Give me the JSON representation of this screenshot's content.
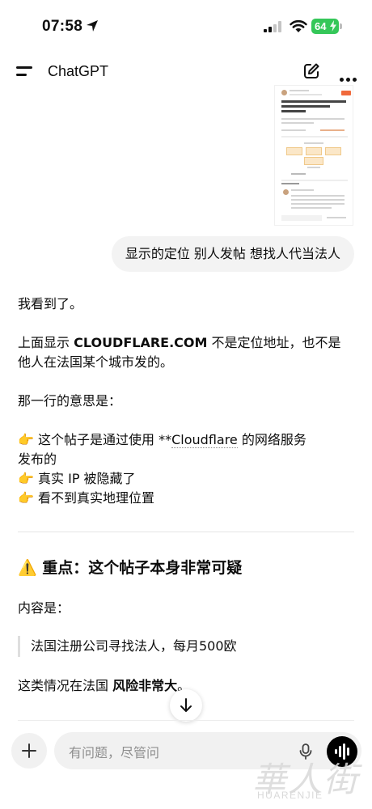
{
  "status_bar": {
    "time": "07:58",
    "battery_level": "64"
  },
  "nav": {
    "title": "ChatGPT"
  },
  "user_message": "显示的定位 别人发帖 想找人代当法人",
  "assistant": {
    "p1": "我看到了。",
    "p2_prefix": "上面显示 ",
    "p2_bold": "CLOUDFLARE.COM",
    "p2_suffix": " 不是定位地址，也不是",
    "p2_line2": "他人在法国某个城市发的。",
    "p3": "那一行的意思是：",
    "bullet1_emoji": "👉",
    "bullet1_prefix": " 这个帖子是通过使用 **",
    "bullet1_link": "Cloudflare",
    "bullet1_suffix": " 的网络服务",
    "bullet1_line2": "发布的",
    "bullet2_emoji": "👉",
    "bullet2": " 真实 IP 被隐藏了",
    "bullet3_emoji": "👉",
    "bullet3": " 看不到真实地理位置",
    "heading_emoji": "⚠️",
    "heading": " 重点：这个帖子本身非常可疑",
    "content_label": "内容是：",
    "quote": "法国注册公司寻找法人，每月500欧",
    "p_last_prefix": "这类情况在法国 ",
    "p_last_bold": "风险非常大",
    "p_last_suffix": "。"
  },
  "composer": {
    "placeholder": "有问题，尽管问"
  },
  "watermark": {
    "cn": "華人街",
    "en": "HUARENJIE"
  }
}
